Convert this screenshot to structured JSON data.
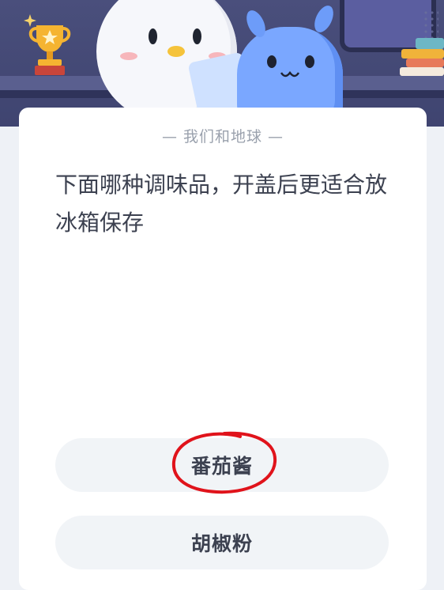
{
  "colors": {
    "hero_bg": "#4a4f7c",
    "card_bg": "#ffffff",
    "option_bg": "#f1f4f7",
    "question_text": "#3c4150",
    "subtitle_text": "#9aa1ad",
    "highlight_circle": "#e0131b"
  },
  "header": {
    "illustration_icons": [
      "trophy-icon",
      "white-bird-character",
      "blue-alien-character",
      "books-icon"
    ]
  },
  "card": {
    "subtitle": "— 我们和地球 —",
    "question": "下面哪种调味品，开盖后更适合放冰箱保存",
    "options": [
      {
        "label": "番茄酱",
        "circled": true
      },
      {
        "label": "胡椒粉",
        "circled": false
      }
    ]
  }
}
